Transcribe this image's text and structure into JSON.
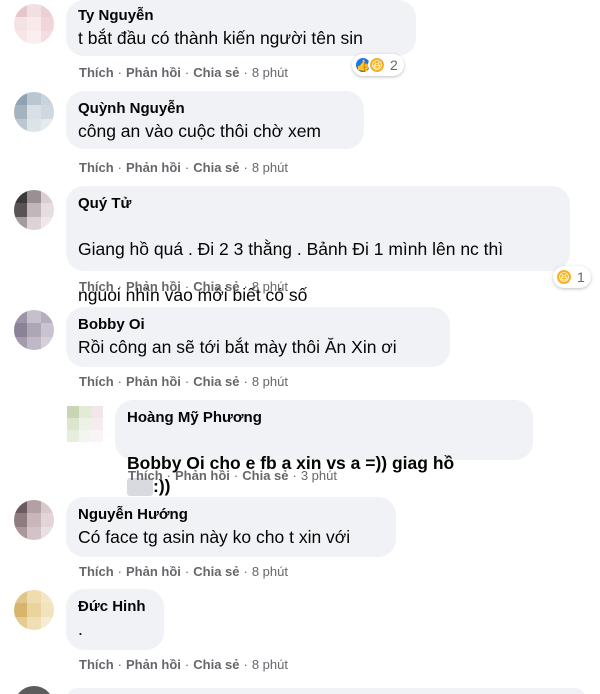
{
  "comments": [
    {
      "author": "Ty Nguyễn",
      "text": "t bắt đầu có thành kiến người tên sin",
      "actions": {
        "like": "Thích",
        "reply": "Phản hồi",
        "share": "Chia sẻ",
        "time": "8 phút"
      },
      "reactions": {
        "icons": [
          "like-icon",
          "haha-icon"
        ],
        "count": "2"
      }
    },
    {
      "author": "Quỳnh Nguyễn",
      "text": "công an vào cuộc thôi chờ xem",
      "actions": {
        "like": "Thích",
        "reply": "Phản hồi",
        "share": "Chia sẻ",
        "time": "8 phút"
      }
    },
    {
      "author": "Quý Tử",
      "text_line1": "Giang hồ quá . Đi 2 3 thằng . Bảnh Đi 1 mình lên nc thì",
      "text_line2": "nguoi nhìn vao mới biết có số",
      "actions": {
        "like": "Thích",
        "reply": "Phản hồi",
        "share": "Chia sẻ",
        "time": "8 phút"
      },
      "reactions": {
        "icons": [
          "haha-icon"
        ],
        "count": "1"
      }
    },
    {
      "author": "Bobby Oi",
      "text": "Rồi công an sẽ tới bắt mày thôi Ăn Xin ơi",
      "actions": {
        "like": "Thích",
        "reply": "Phản hồi",
        "share": "Chia sẻ",
        "time": "8 phút"
      }
    },
    {
      "author": "Hoàng Mỹ Phương",
      "text_a": "Bobby Oi cho e fb a xin vs a =)) giag hồ",
      "text_b": ":))",
      "actions": {
        "like": "Thích",
        "reply": "Phản hồi",
        "share": "Chia sẻ",
        "time": "3 phút"
      }
    },
    {
      "author": "Nguyễn Hướng",
      "text": "Có face tg asin này ko cho t xin với",
      "actions": {
        "like": "Thích",
        "reply": "Phản hồi",
        "share": "Chia sẻ",
        "time": "8 phút"
      }
    },
    {
      "author": "Đức Hinh",
      "text": ".",
      "actions": {
        "like": "Thích",
        "reply": "Phản hồi",
        "share": "Chia sẻ",
        "time": "8 phút"
      }
    }
  ],
  "colors": {
    "bubble": "#f0f2f5",
    "action_text": "#65676b",
    "like": "#1877f2",
    "haha": "#f7b125"
  }
}
